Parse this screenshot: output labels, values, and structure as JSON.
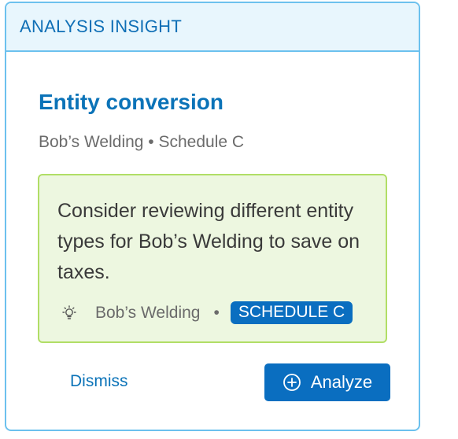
{
  "card": {
    "header_title": "ANALYSIS INSIGHT",
    "title": "Entity conversion",
    "subtitle": "Bob’s Welding • Schedule C"
  },
  "insight": {
    "message": "Consider reviewing different entity types for Bob’s Welding to save on taxes.",
    "icon": "lightbulb-icon",
    "entity": "Bob’s Welding",
    "separator": "•",
    "badge": "SCHEDULE C"
  },
  "actions": {
    "dismiss_label": "Dismiss",
    "analyze_label": "Analyze",
    "analyze_icon": "plus-circle-icon"
  },
  "colors": {
    "header_bg": "#e8f6fd",
    "card_border": "#6cc1ee",
    "accent_blue": "#0b73b8",
    "insight_bg": "#edf7e0",
    "insight_border": "#b1de66",
    "button_bg": "#0a6ec0"
  }
}
